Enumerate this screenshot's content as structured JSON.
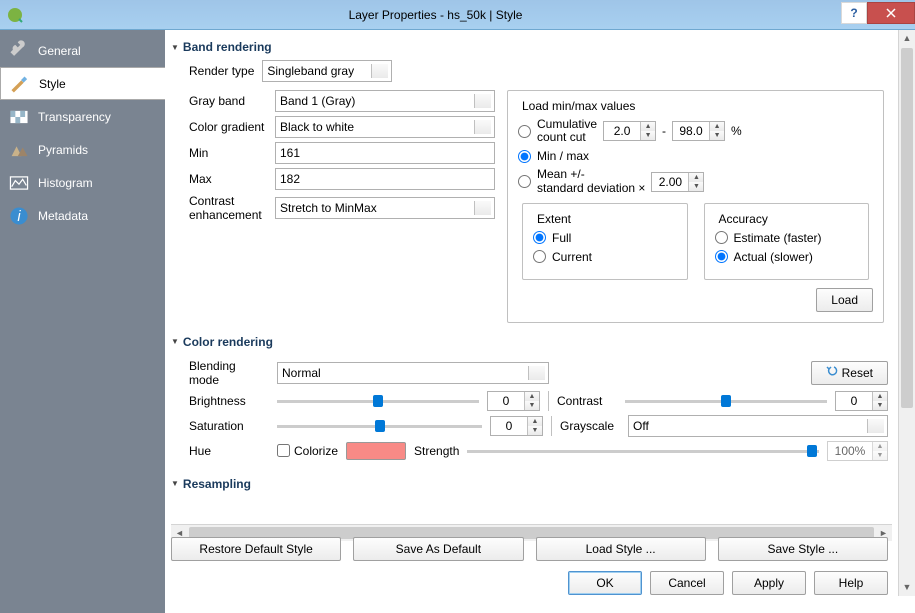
{
  "title": "Layer Properties - hs_50k | Style",
  "sidebar": {
    "items": [
      {
        "label": "General"
      },
      {
        "label": "Style"
      },
      {
        "label": "Transparency"
      },
      {
        "label": "Pyramids"
      },
      {
        "label": "Histogram"
      },
      {
        "label": "Metadata"
      }
    ]
  },
  "band_rendering": {
    "title": "Band rendering",
    "render_type_label": "Render type",
    "render_type": "Singleband gray",
    "gray_band_label": "Gray band",
    "gray_band": "Band 1 (Gray)",
    "color_gradient_label": "Color gradient",
    "color_gradient": "Black to white",
    "min_label": "Min",
    "min": "161",
    "max_label": "Max",
    "max": "182",
    "contrast_label_1": "Contrast",
    "contrast_label_2": "enhancement",
    "contrast": "Stretch to MinMax"
  },
  "load_minmax": {
    "title": "Load min/max values",
    "cumulative_label": "Cumulative\ncount cut",
    "cum_lo": "2.0",
    "dash": "-",
    "cum_hi": "98.0",
    "percent": "%",
    "minmax_label": "Min / max",
    "meanstd_label": "Mean +/-\nstandard deviation ×",
    "meanstd_val": "2.00",
    "extent_title": "Extent",
    "extent_full": "Full",
    "extent_current": "Current",
    "accuracy_title": "Accuracy",
    "accuracy_estimate": "Estimate (faster)",
    "accuracy_actual": "Actual (slower)",
    "load_btn": "Load"
  },
  "color_rendering": {
    "title": "Color rendering",
    "blending_label": "Blending mode",
    "blending": "Normal",
    "reset": "Reset",
    "brightness_label": "Brightness",
    "brightness": "0",
    "contrast_label": "Contrast",
    "contrast": "0",
    "saturation_label": "Saturation",
    "saturation": "0",
    "grayscale_label": "Grayscale",
    "grayscale": "Off",
    "hue_label": "Hue",
    "colorize_label": "Colorize",
    "strength_label": "Strength",
    "strength": "100%"
  },
  "resampling": {
    "title": "Resampling"
  },
  "buttons": {
    "restore": "Restore Default Style",
    "save_default": "Save As Default",
    "load_style": "Load Style ...",
    "save_style": "Save Style ...",
    "ok": "OK",
    "cancel": "Cancel",
    "apply": "Apply",
    "help": "Help"
  }
}
